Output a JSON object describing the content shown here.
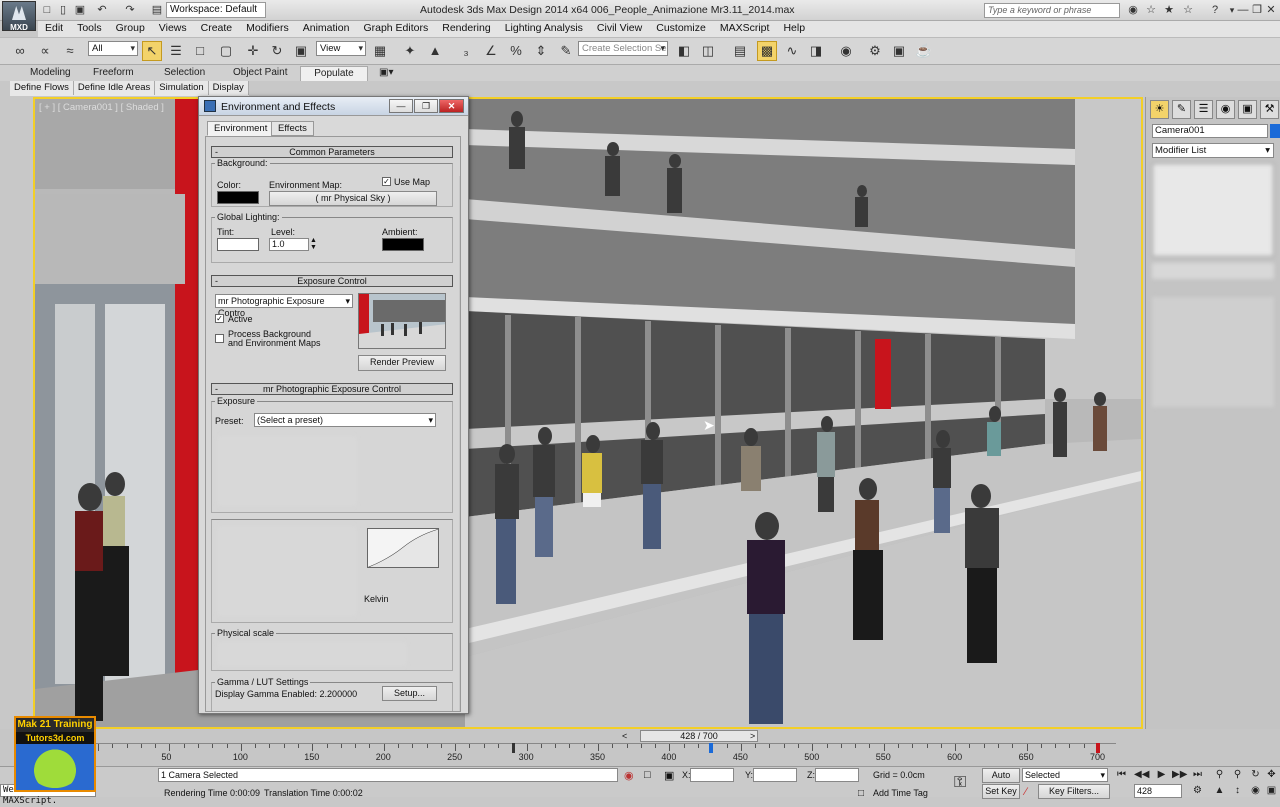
{
  "titlebar": {
    "logo": "MXD",
    "workspace": "Workspace: Default",
    "title": "Autodesk 3ds Max Design 2014 x64     006_People_Animazione Mr3.11_2014.max",
    "search_placeholder": "Type a keyword or phrase"
  },
  "menu": [
    "Edit",
    "Tools",
    "Group",
    "Views",
    "Create",
    "Modifiers",
    "Animation",
    "Graph Editors",
    "Rendering",
    "Lighting Analysis",
    "Civil View",
    "Customize",
    "MAXScript",
    "Help"
  ],
  "toolbar": {
    "filter": "All",
    "refcoord": "View",
    "selset_placeholder": "Create Selection Se"
  },
  "ribbon": {
    "tabs": [
      "Modeling",
      "Freeform",
      "Selection",
      "Object Paint",
      "Populate"
    ],
    "subtabs": [
      "Define Flows",
      "Define Idle Areas",
      "Simulation",
      "Display"
    ]
  },
  "viewport": {
    "label": "[ + ] [ Camera001 ] [ Shaded ]"
  },
  "command_panel": {
    "object_name": "Camera001",
    "modifier_list": "Modifier List",
    "name_color": "#1a6ad8"
  },
  "dialog": {
    "title": "Environment and Effects",
    "tabs": [
      "Environment",
      "Effects"
    ],
    "common": {
      "header": "Common Parameters",
      "background": "Background:",
      "color": "Color:",
      "env_map": "Environment Map:",
      "use_map": "Use Map",
      "map_button": "( mr Physical Sky )",
      "global_lighting": "Global Lighting:",
      "tint": "Tint:",
      "level": "Level:",
      "level_value": "1.0",
      "ambient": "Ambient:"
    },
    "exposure": {
      "header": "Exposure Control",
      "selected": "mr Photographic Exposure Contro",
      "active": "Active",
      "process_bg_1": "Process Background",
      "process_bg_2": "and Environment Maps",
      "render_preview": "Render Preview"
    },
    "mr_exposure": {
      "header": "mr Photographic Exposure Control",
      "exposure": "Exposure",
      "preset": "Preset:",
      "preset_value": "(Select a preset)",
      "kelvin": "Kelvin",
      "physical_scale": "Physical scale",
      "gamma_lut": "Gamma / LUT Settings",
      "display_gamma": "Display Gamma Enabled:  2.200000",
      "setup": "Setup..."
    }
  },
  "timeline": {
    "slider": "428 / 700",
    "ticks": [
      "50",
      "100",
      "150",
      "200",
      "250",
      "300",
      "350",
      "400",
      "450",
      "500",
      "550",
      "600",
      "650",
      "700"
    ],
    "current_frame": 428,
    "total_frames": 700
  },
  "status": {
    "selected": "1 Camera Selected",
    "rendering_time": "Rendering Time  0:00:09",
    "translation_time": "Translation Time  0:00:02",
    "x": "X:",
    "y": "Y:",
    "z": "Z:",
    "grid": "Grid = 0.0cm",
    "add_time_tag": "Add Time Tag",
    "auto_key": "Auto Key",
    "set_key": "Set Key",
    "key_mode": "Selected",
    "key_filters": "Key Filters...",
    "frame": "428",
    "script": "Welcome to MAXScript."
  },
  "watermark": {
    "line1": "Mak 21 Training",
    "line2": "Tutors3d.com"
  }
}
